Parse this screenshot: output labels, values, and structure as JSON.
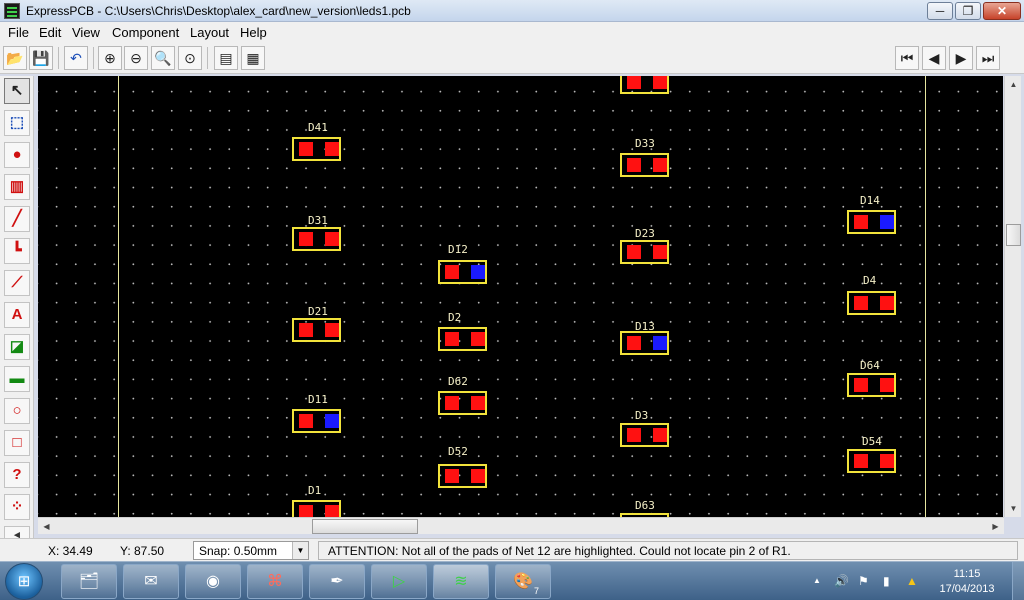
{
  "window": {
    "title": "ExpressPCB - C:\\Users\\Chris\\Desktop\\alex_card\\new_version\\leds1.pcb",
    "min_glyph": "─",
    "max_glyph": "❐",
    "close_glyph": "✕"
  },
  "menu": {
    "items": [
      "File",
      "Edit",
      "View",
      "Component",
      "Layout",
      "Help"
    ]
  },
  "toolbar": {
    "open": "📂",
    "save": "💾",
    "undo": "↶",
    "zoom_in": "⊕",
    "zoom_out": "⊖",
    "zoom_fit": "🔍",
    "zoom_page": "⊙",
    "properties": "▤",
    "component_manager": "▦",
    "nav_first": "⏮",
    "nav_prev": "◀",
    "nav_next": "▶",
    "nav_last": "⏭"
  },
  "palette": {
    "select": "↖",
    "zoom_tool": "⬚",
    "pad": "●",
    "component": "▥",
    "trace": "╱",
    "trace_corner": "┗",
    "wire": "⟋",
    "text": "A",
    "layer": "◪",
    "filled_plane": "▬",
    "circle": "○",
    "rectangle": "□",
    "query": "?",
    "netlist": "⁘",
    "more": "◂"
  },
  "pcb": {
    "colors": {
      "background": "#000000",
      "pad": "#ff1111",
      "pad_highlighted": "#1a1aff",
      "silkscreen": "#f2e33b"
    },
    "components": [
      {
        "label": "",
        "highlight": [
          false,
          false
        ]
      },
      {
        "label": "D41",
        "highlight": [
          false,
          false
        ]
      },
      {
        "label": "D33",
        "highlight": [
          false,
          false
        ]
      },
      {
        "label": "D14",
        "highlight": [
          false,
          true
        ]
      },
      {
        "label": "D31",
        "highlight": [
          false,
          false
        ]
      },
      {
        "label": "D12",
        "highlight": [
          false,
          true
        ]
      },
      {
        "label": "D23",
        "highlight": [
          false,
          false
        ]
      },
      {
        "label": "D4",
        "highlight": [
          false,
          false
        ]
      },
      {
        "label": "D21",
        "highlight": [
          false,
          false
        ]
      },
      {
        "label": "D2",
        "highlight": [
          false,
          false
        ]
      },
      {
        "label": "D13",
        "highlight": [
          false,
          true
        ]
      },
      {
        "label": "D64",
        "highlight": [
          false,
          false
        ]
      },
      {
        "label": "D11",
        "highlight": [
          false,
          true
        ]
      },
      {
        "label": "D62",
        "highlight": [
          false,
          false
        ]
      },
      {
        "label": "D3",
        "highlight": [
          false,
          false
        ]
      },
      {
        "label": "D54",
        "highlight": [
          false,
          false
        ]
      },
      {
        "label": "D52",
        "highlight": [
          false,
          false
        ]
      },
      {
        "label": "D1",
        "highlight": [
          false,
          false
        ]
      },
      {
        "label": "D63",
        "highlight": [
          false,
          false
        ]
      }
    ]
  },
  "scroll": {
    "up": "▲",
    "down": "▼",
    "left": "◀",
    "right": "▶"
  },
  "status": {
    "x": "X: 34.49",
    "y": "Y: 87.50",
    "snap": "Snap:  0.50mm",
    "snap_arrow": "▼",
    "message": "ATTENTION:  Not all of the pads of Net 12 are highlighted.  Could not locate pin 2 of R1."
  },
  "taskbar": {
    "start": "⊞",
    "apps": [
      {
        "name": "explorer",
        "glyph": "🗂"
      },
      {
        "name": "thunderbird",
        "glyph": "✉"
      },
      {
        "name": "chrome",
        "glyph": "◉"
      },
      {
        "name": "acrobat",
        "glyph": "⌘"
      },
      {
        "name": "inkscape",
        "glyph": "✒"
      },
      {
        "name": "expresssch",
        "glyph": "▷"
      },
      {
        "name": "expresspcb",
        "glyph": "≋"
      },
      {
        "name": "paint",
        "glyph": "🎨",
        "badge": "7"
      }
    ],
    "tray": {
      "arrow": "▲",
      "volume": "🔊",
      "flag": "⚑",
      "network": "▮",
      "drive": "▲"
    },
    "time": "11:15",
    "date": "17/04/2013"
  }
}
